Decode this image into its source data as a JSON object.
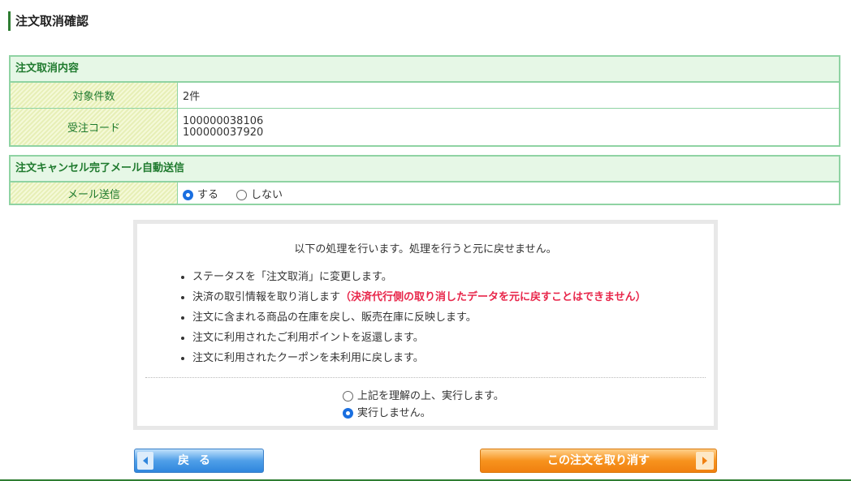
{
  "page_title": "注文取消確認",
  "cancel_details": {
    "heading": "注文取消内容",
    "count_label": "対象件数",
    "count_value": "2件",
    "code_label": "受注コード",
    "codes": [
      "100000038106",
      "100000037920"
    ]
  },
  "mail_section": {
    "heading": "注文キャンセル完了メール自動送信",
    "label": "メール送信",
    "options": [
      {
        "label": "する",
        "checked": true
      },
      {
        "label": "しない",
        "checked": false
      }
    ]
  },
  "confirm": {
    "lead": "以下の処理を行います。処理を行うと元に戻せません。",
    "items": [
      {
        "text": "ステータスを「注文取消」に変更します。",
        "warning": ""
      },
      {
        "text": "決済の取引情報を取り消します",
        "warning": "（決済代行側の取り消したデータを元に戻すことはできません）"
      },
      {
        "text": "注文に含まれる商品の在庫を戻し、販売在庫に反映します。",
        "warning": ""
      },
      {
        "text": "注文に利用されたご利用ポイントを返還します。",
        "warning": ""
      },
      {
        "text": "注文に利用されたクーポンを未利用に戻します。",
        "warning": ""
      }
    ],
    "choices": [
      {
        "label": "上記を理解の上、実行します。",
        "checked": false
      },
      {
        "label": "実行しません。",
        "checked": true
      }
    ]
  },
  "buttons": {
    "back_label": "戻る",
    "cancel_label": "この注文を取り消す"
  },
  "colors": {
    "accent_green": "#1f7a2e",
    "border_green": "#8fd3a3",
    "warning_red": "#e8264a",
    "radio_blue": "#1a6fe0"
  }
}
